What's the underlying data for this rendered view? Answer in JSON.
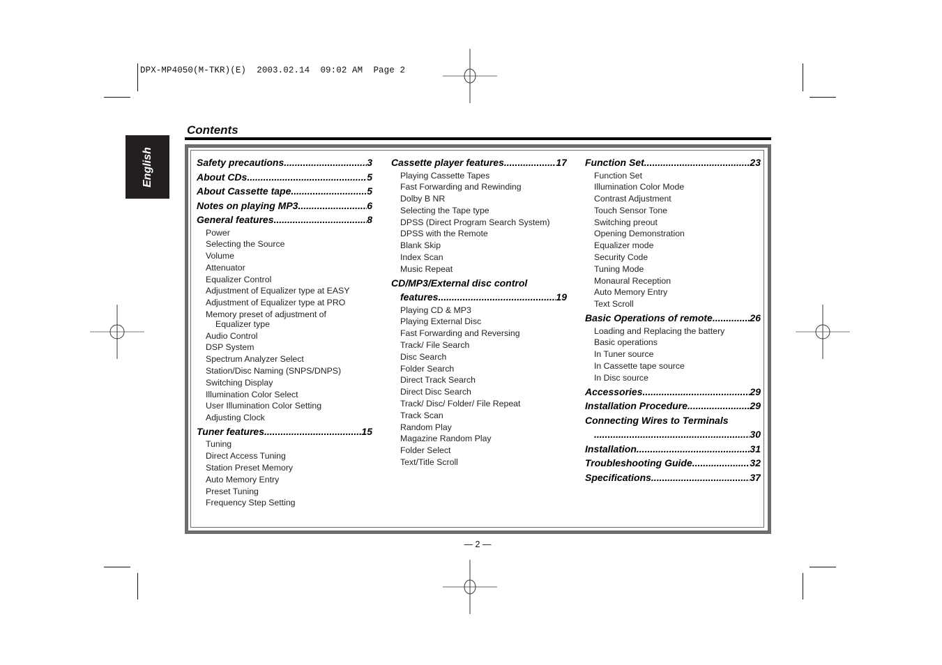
{
  "slug_line": "DPX-MP4050(M-TKR)(E)  2003.02.14  09:02 AM  Page 2",
  "language_tab": "English",
  "page_title": "Contents",
  "page_number": "— 2 —",
  "columns": [
    {
      "entries": [
        {
          "type": "heading",
          "title": "Safety precautions",
          "page": "3"
        },
        {
          "type": "heading",
          "title": "About CDs",
          "page": "5"
        },
        {
          "type": "heading",
          "title": "About Cassette tape ",
          "page": "5"
        },
        {
          "type": "heading",
          "title": "Notes on playing MP3 ",
          "page": "6"
        },
        {
          "type": "heading",
          "title": "General features ",
          "page": "8"
        },
        {
          "type": "sub",
          "title": "Power"
        },
        {
          "type": "sub",
          "title": "Selecting the Source"
        },
        {
          "type": "sub",
          "title": "Volume"
        },
        {
          "type": "sub",
          "title": "Attenuator"
        },
        {
          "type": "sub",
          "title": "Equalizer Control"
        },
        {
          "type": "sub",
          "title": "Adjustment of Equalizer type at EASY"
        },
        {
          "type": "sub",
          "title": "Adjustment of Equalizer type at PRO"
        },
        {
          "type": "sub2",
          "title": "Memory preset of adjustment of",
          "cont": "Equalizer type"
        },
        {
          "type": "sub",
          "title": "Audio Control"
        },
        {
          "type": "sub",
          "title": "DSP System"
        },
        {
          "type": "sub",
          "title": "Spectrum Analyzer Select"
        },
        {
          "type": "sub",
          "title": "Station/Disc Naming (SNPS/DNPS)"
        },
        {
          "type": "sub",
          "title": "Switching Display"
        },
        {
          "type": "sub",
          "title": "Illumination Color Select"
        },
        {
          "type": "sub",
          "title": "User Illumination Color Setting"
        },
        {
          "type": "sub",
          "title": "Adjusting Clock"
        },
        {
          "type": "heading",
          "title": "Tuner features",
          "page": "15"
        },
        {
          "type": "sub",
          "title": "Tuning"
        },
        {
          "type": "sub",
          "title": "Direct Access Tuning"
        },
        {
          "type": "sub",
          "title": "Station Preset Memory"
        },
        {
          "type": "sub",
          "title": "Auto Memory Entry"
        },
        {
          "type": "sub",
          "title": "Preset Tuning"
        },
        {
          "type": "sub",
          "title": "Frequency Step Setting"
        }
      ]
    },
    {
      "entries": [
        {
          "type": "heading",
          "title": "Cassette player features",
          "page": "17"
        },
        {
          "type": "sub",
          "title": "Playing Cassette Tapes"
        },
        {
          "type": "sub",
          "title": "Fast Forwarding and Rewinding"
        },
        {
          "type": "sub",
          "title": "Dolby B NR"
        },
        {
          "type": "sub",
          "title": "Selecting the Tape type"
        },
        {
          "type": "sub",
          "title": "DPSS (Direct Program Search System)"
        },
        {
          "type": "sub",
          "title": "DPSS with the Remote"
        },
        {
          "type": "sub",
          "title": "Blank Skip"
        },
        {
          "type": "sub",
          "title": "Index Scan"
        },
        {
          "type": "sub",
          "title": "Music Repeat"
        },
        {
          "type": "heading2",
          "title": "CD/MP3/External disc control",
          "title2": "features ",
          "page": "19"
        },
        {
          "type": "sub",
          "title": "Playing CD & MP3"
        },
        {
          "type": "sub",
          "title": "Playing External Disc"
        },
        {
          "type": "sub",
          "title": "Fast Forwarding and Reversing"
        },
        {
          "type": "sub",
          "title": "Track/ File Search"
        },
        {
          "type": "sub",
          "title": "Disc Search"
        },
        {
          "type": "sub",
          "title": "Folder Search"
        },
        {
          "type": "sub",
          "title": "Direct Track Search"
        },
        {
          "type": "sub",
          "title": "Direct Disc Search"
        },
        {
          "type": "sub",
          "title": "Track/ Disc/ Folder/ File Repeat"
        },
        {
          "type": "sub",
          "title": "Track Scan"
        },
        {
          "type": "sub",
          "title": "Random Play"
        },
        {
          "type": "sub",
          "title": "Magazine Random Play"
        },
        {
          "type": "sub",
          "title": "Folder Select"
        },
        {
          "type": "sub",
          "title": "Text/Title Scroll"
        }
      ]
    },
    {
      "entries": [
        {
          "type": "heading",
          "title": "Function Set",
          "page": "23"
        },
        {
          "type": "sub",
          "title": "Function Set"
        },
        {
          "type": "sub",
          "title": "Illumination Color Mode"
        },
        {
          "type": "sub",
          "title": "Contrast Adjustment"
        },
        {
          "type": "sub",
          "title": "Touch Sensor Tone"
        },
        {
          "type": "sub",
          "title": "Switching preout"
        },
        {
          "type": "sub",
          "title": "Opening Demonstration"
        },
        {
          "type": "sub",
          "title": "Equalizer mode"
        },
        {
          "type": "sub",
          "title": "Security Code"
        },
        {
          "type": "sub",
          "title": "Tuning Mode"
        },
        {
          "type": "sub",
          "title": "Monaural Reception"
        },
        {
          "type": "sub",
          "title": "Auto Memory Entry"
        },
        {
          "type": "sub",
          "title": "Text Scroll"
        },
        {
          "type": "heading",
          "title": "Basic Operations of remote",
          "page": "26"
        },
        {
          "type": "sub",
          "title": "Loading and Replacing the battery"
        },
        {
          "type": "sub",
          "title": "Basic operations"
        },
        {
          "type": "sub",
          "title": "In Tuner source"
        },
        {
          "type": "sub",
          "title": "In Cassette tape source"
        },
        {
          "type": "sub",
          "title": "In Disc source"
        },
        {
          "type": "heading",
          "title": "Accessories",
          "page": "29"
        },
        {
          "type": "heading",
          "title": "Installation Procedure ",
          "page": "29"
        },
        {
          "type": "heading2",
          "title": "Connecting Wires to Terminals",
          "title2": "",
          "page": "30"
        },
        {
          "type": "heading",
          "title": "Installation ",
          "page": "31"
        },
        {
          "type": "heading",
          "title": "Troubleshooting Guide ",
          "page": "32"
        },
        {
          "type": "heading",
          "title": "Specifications ",
          "page": "37"
        }
      ]
    }
  ]
}
